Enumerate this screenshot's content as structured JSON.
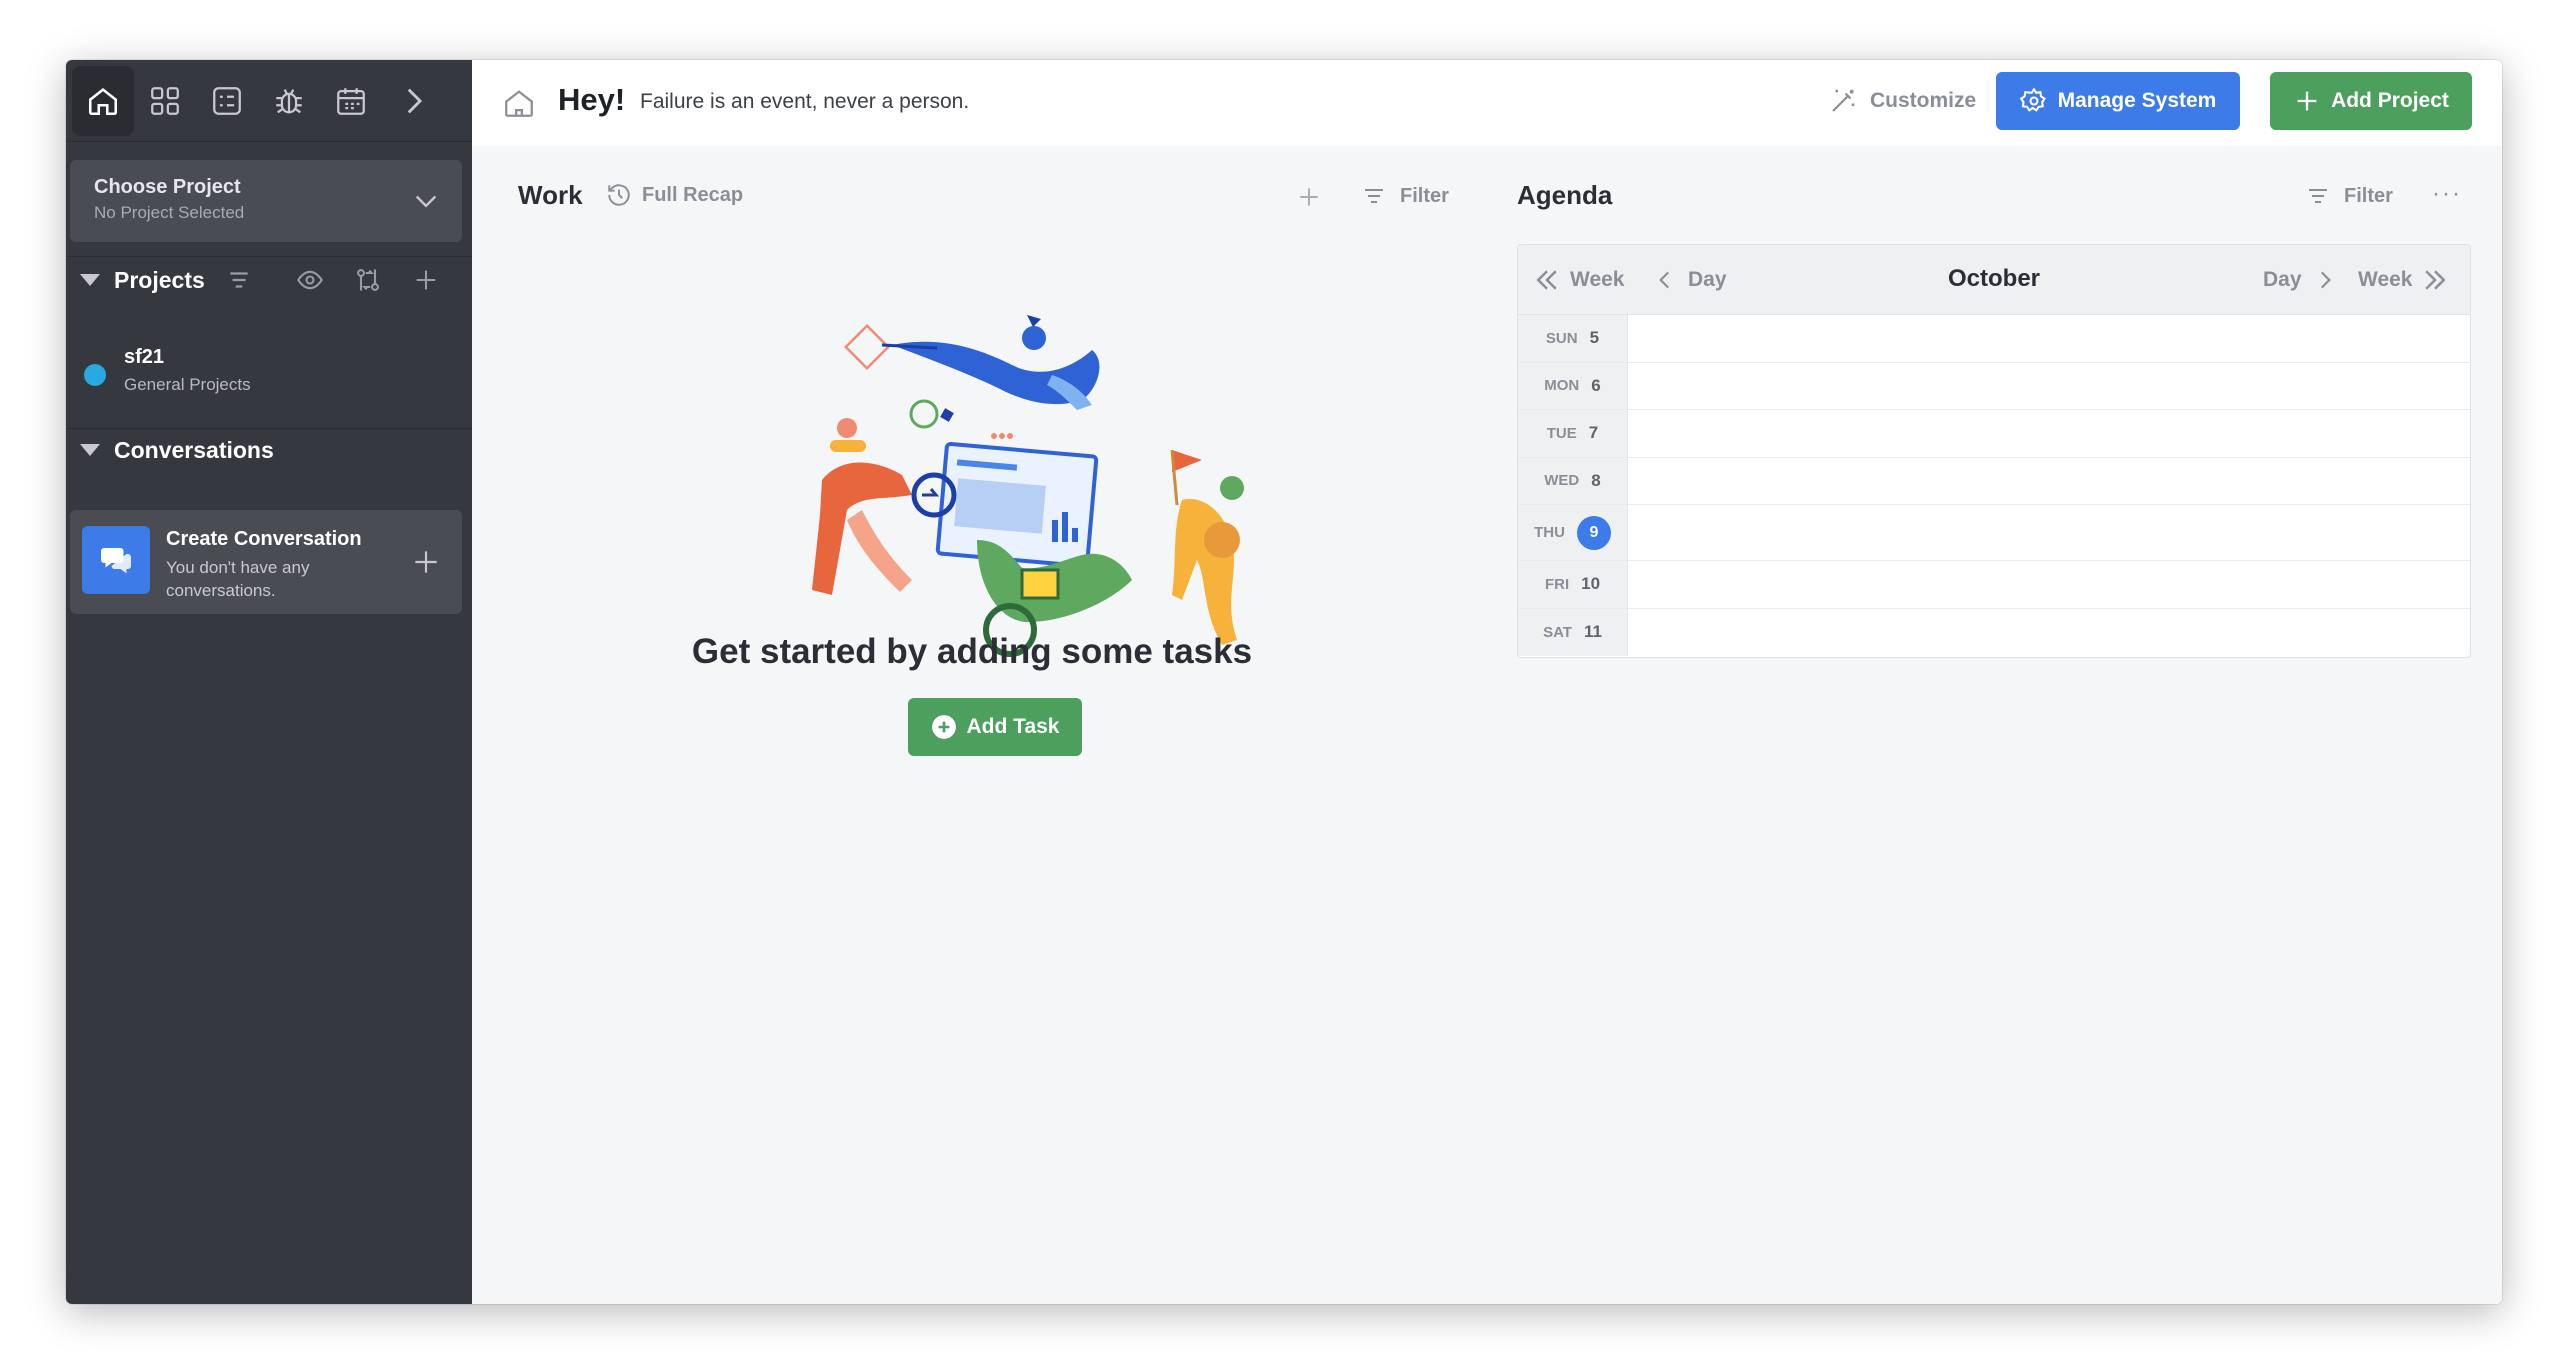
{
  "sidebar": {
    "chooser": {
      "title": "Choose Project",
      "subtitle": "No Project Selected"
    },
    "projects": {
      "title": "Projects",
      "items": [
        {
          "name": "sf21",
          "subtitle": "General Projects",
          "color": "#27a9e1"
        }
      ]
    },
    "conversations": {
      "title": "Conversations",
      "card": {
        "title": "Create Conversation",
        "subtitle": "You don't have any conversations."
      }
    }
  },
  "header": {
    "greeting": "Hey!",
    "quote": "Failure is an event, never a person.",
    "customize_label": "Customize",
    "manage_label": "Manage System",
    "add_project_label": "Add Project"
  },
  "work": {
    "title": "Work",
    "recap_label": "Full Recap",
    "filter_label": "Filter",
    "empty_heading": "Get started by adding some tasks",
    "add_task_label": "Add Task"
  },
  "agenda": {
    "title": "Agenda",
    "filter_label": "Filter",
    "nav": {
      "prev_week": "Week",
      "prev_day": "Day",
      "month": "October",
      "next_day": "Day",
      "next_week": "Week"
    },
    "days": [
      {
        "dow": "SUN",
        "num": "5"
      },
      {
        "dow": "MON",
        "num": "6"
      },
      {
        "dow": "TUE",
        "num": "7"
      },
      {
        "dow": "WED",
        "num": "8"
      },
      {
        "dow": "THU",
        "num": "9"
      },
      {
        "dow": "FRI",
        "num": "10"
      },
      {
        "dow": "SAT",
        "num": "11"
      }
    ],
    "today_index": 4
  },
  "colors": {
    "sidebar_bg": "#36383f",
    "accent_blue": "#3d7be8",
    "accent_green": "#4c9f5c",
    "project_dot": "#27a9e1"
  }
}
